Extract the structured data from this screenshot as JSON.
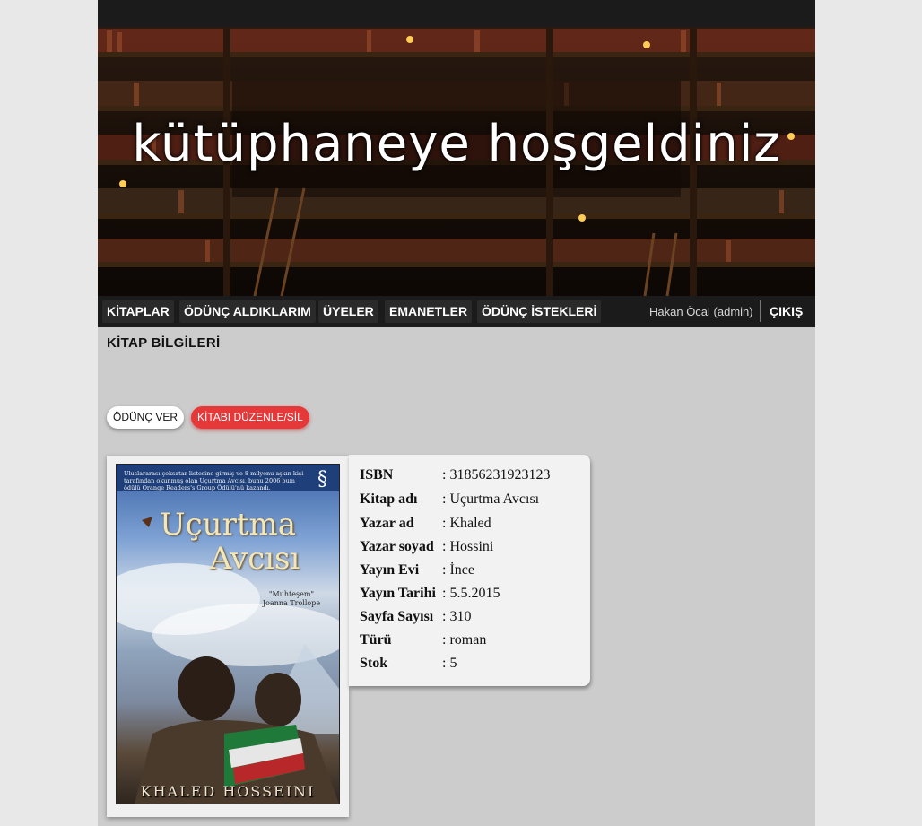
{
  "banner": {
    "title": "kütüphaneye hoşgeldiniz"
  },
  "nav": {
    "items": [
      "KİTAPLAR",
      "ÖDÜNÇ ALDIKLARIM",
      "ÜYELER",
      "EMANETLER",
      "ÖDÜNÇ İSTEKLERİ"
    ],
    "user": "Hakan Öcal (admin)",
    "logout": "ÇIKIŞ"
  },
  "page": {
    "title": "KİTAP BİLGİLERİ",
    "lend_button": "ÖDÜNÇ VER",
    "edit_button": "KİTABI DÜZENLE/SİL"
  },
  "cover": {
    "blurb": "Uluslararası çoksatar listesine girmiş ve 8 milyonu aşkın kişi tarafından okunmuş olan Uçurtma Avcısı, bunu 2006 bum ödülü Orange Readers's Group Ödülü'nü kazandı.",
    "title_line1": "Uçurtma",
    "title_line2": "Avcısı",
    "quote_line1": "\"Muhteşem\"",
    "quote_line2": "Joanna Trollope",
    "author": "KHALED HOSSEINI",
    "publisher_mark": "§"
  },
  "book": {
    "fields": [
      {
        "label": "ISBN",
        "value": ": 31856231923123"
      },
      {
        "label": "Kitap adı",
        "value": ": Uçurtma Avcısı"
      },
      {
        "label": "Yazar ad",
        "value": ": Khaled"
      },
      {
        "label": "Yazar soyad",
        "value": ": Hossini"
      },
      {
        "label": "Yayın Evi",
        "value": ": İnce"
      },
      {
        "label": "Yayın Tarihi",
        "value": ": 5.5.2015"
      },
      {
        "label": "Sayfa Sayısı",
        "value": ": 310"
      },
      {
        "label": "Türü",
        "value": ": roman"
      },
      {
        "label": "Stok",
        "value": ": 5"
      }
    ]
  }
}
